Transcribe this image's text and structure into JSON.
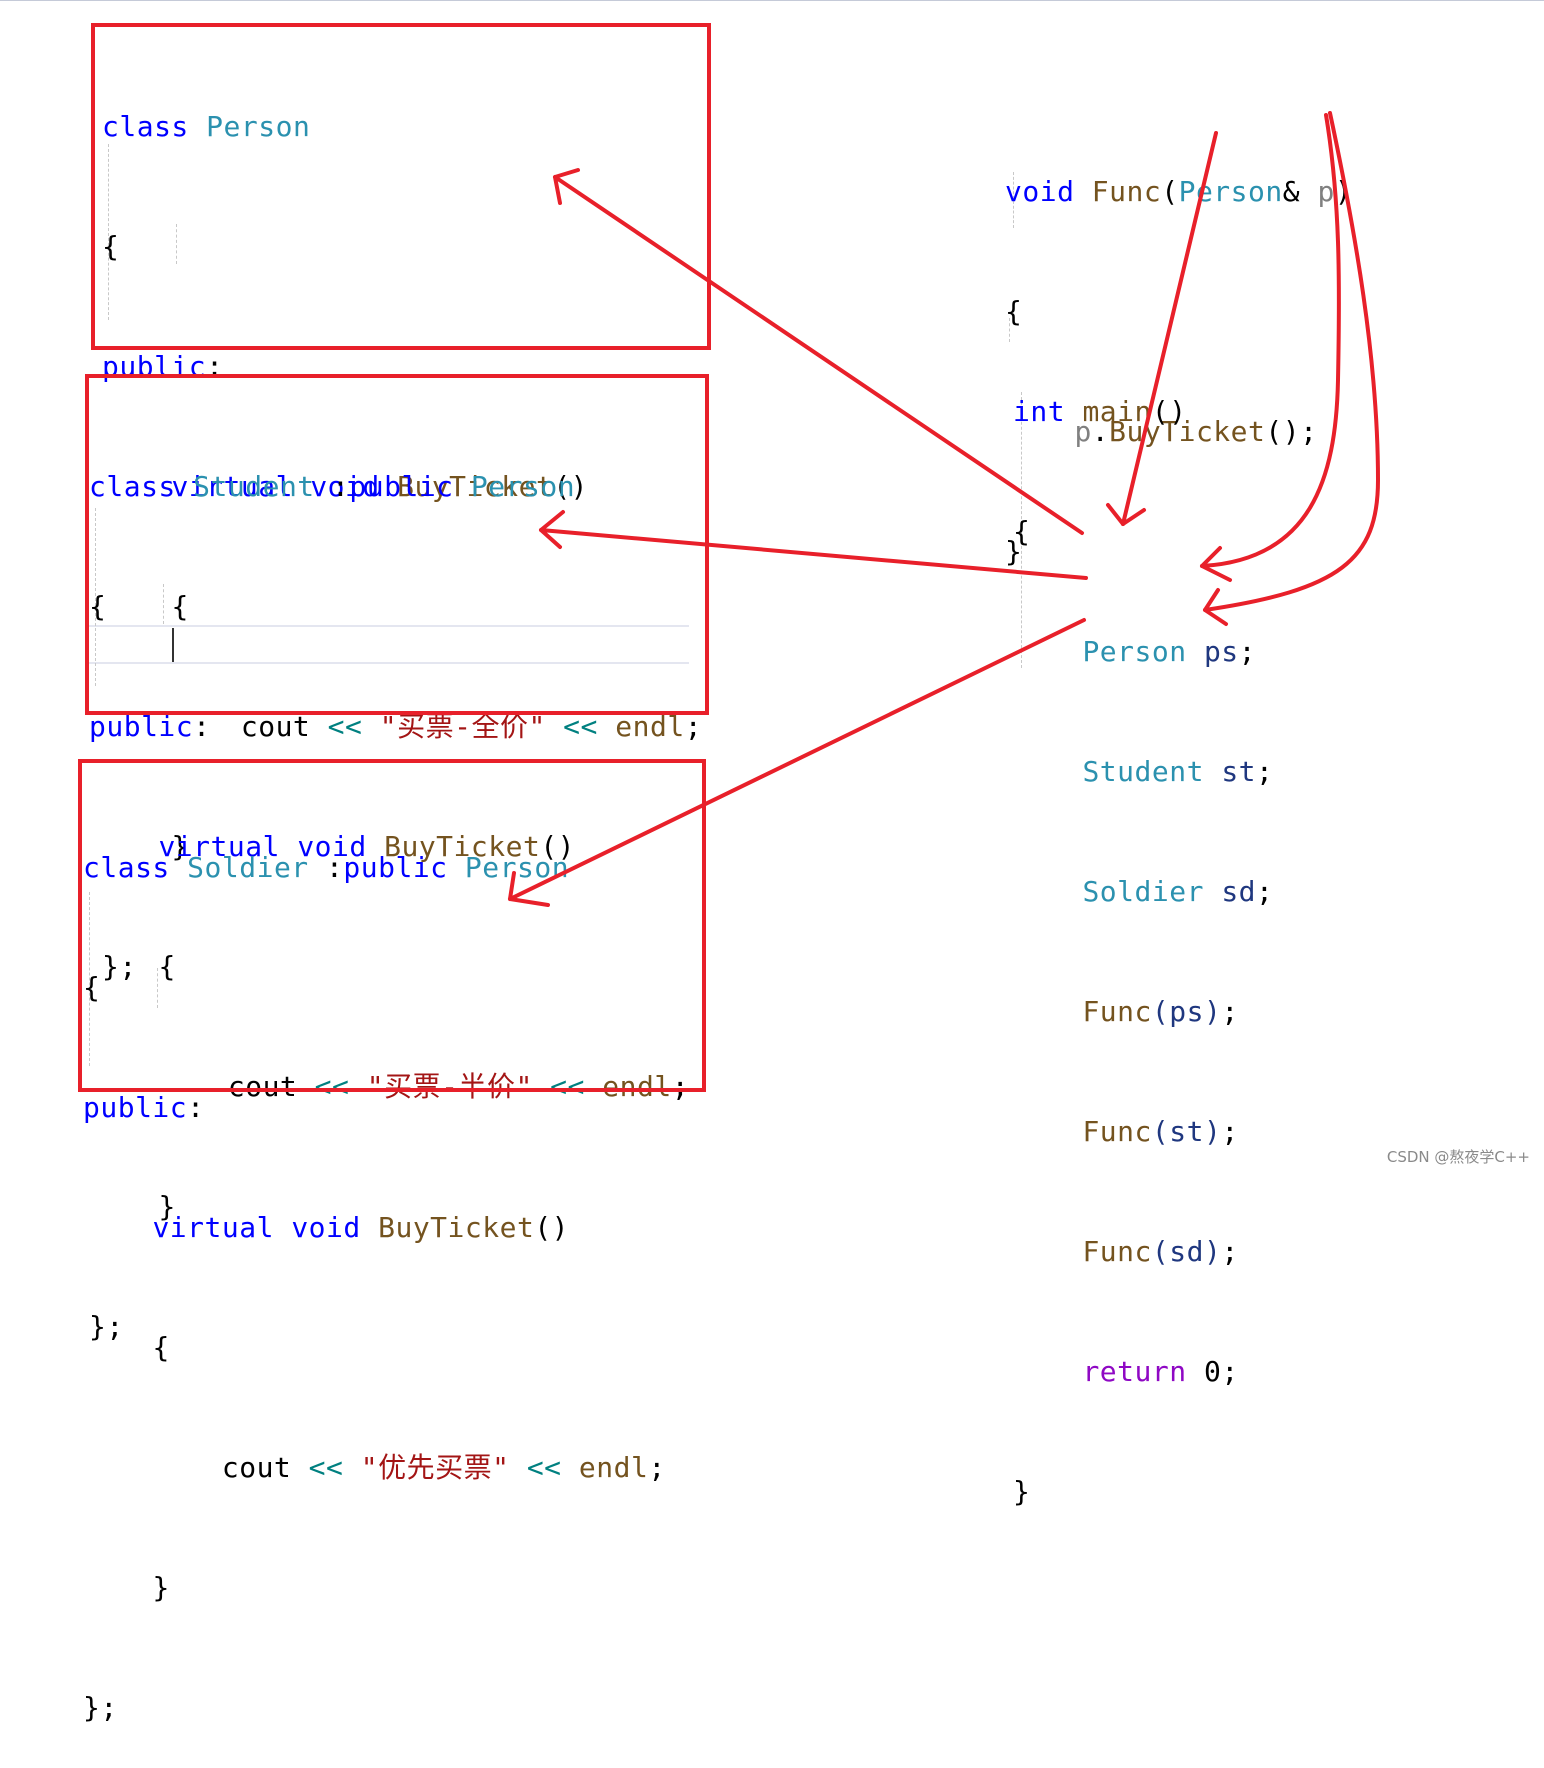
{
  "colors": {
    "keyword": "#0000ff",
    "type": "#2b91af",
    "function": "#74531f",
    "string": "#a31515",
    "operator": "#008080",
    "parameter": "#808080",
    "local": "#1f377f",
    "control": "#8f08c4",
    "annotation": "#e8202a"
  },
  "person_block": {
    "l1": {
      "kw": "class",
      "name": "Person"
    },
    "l2": "{",
    "l3": {
      "kw": "public",
      "colon": ":"
    },
    "l4": {
      "virt": "virtual",
      "void": "void",
      "fn": "BuyTicket",
      "parens": "()"
    },
    "l5": "{",
    "l6": {
      "cout": "cout",
      "op1": "<<",
      "str": "\"买票-全价\"",
      "op2": "<<",
      "endl": "endl",
      "semi": ";"
    },
    "l7": "}",
    "l8": "};"
  },
  "student_block": {
    "l1": {
      "kw": "class",
      "name": "Student",
      "colon": " :",
      "pub": "public",
      "base": "Person"
    },
    "l2": "{",
    "l3": {
      "kw": "public",
      "colon": ":"
    },
    "l4": {
      "virt": "virtual",
      "void": "void",
      "fn": "BuyTicket",
      "parens": "()"
    },
    "l5": "{",
    "l6": {
      "cout": "cout",
      "op1": "<<",
      "str": "\"买票-半价\"",
      "op2": "<<",
      "endl": "endl",
      "semi": ";"
    },
    "l7": "}",
    "l8": "};"
  },
  "soldier_block": {
    "l1": {
      "kw": "class",
      "name": "Soldier",
      "colon": " :",
      "pub": "public",
      "base": "Person"
    },
    "l2": "{",
    "l3": {
      "kw": "public",
      "colon": ":"
    },
    "l4": {
      "virt": "virtual",
      "void": "void",
      "fn": "BuyTicket",
      "parens": "()"
    },
    "l5": "{",
    "l6": {
      "cout": "cout",
      "op1": "<<",
      "str": "\"优先买票\"",
      "op2": "<<",
      "endl": "endl",
      "semi": ";"
    },
    "l7": "}",
    "l8": "};"
  },
  "func_block": {
    "sig": {
      "void": "void",
      "fn": "Func",
      "open": "(",
      "type": "Person",
      "amp": "&",
      "param": "p",
      "close": ")"
    },
    "open": "{",
    "body": {
      "obj": "p",
      "dot": ".",
      "fn": "BuyTicket",
      "rest": "();"
    },
    "close": "}"
  },
  "main_block": {
    "sig": {
      "int": "int",
      "fn": "main",
      "parens": "()"
    },
    "open": "{",
    "decls": [
      {
        "type": "Person",
        "var": "ps",
        "semi": ";"
      },
      {
        "type": "Student",
        "var": "st",
        "semi": ";"
      },
      {
        "type": "Soldier",
        "var": "sd",
        "semi": ";"
      }
    ],
    "calls": [
      {
        "fn": "Func",
        "arg": "(ps)",
        "semi": ";"
      },
      {
        "fn": "Func",
        "arg": "(st)",
        "semi": ";"
      },
      {
        "fn": "Func",
        "arg": "(sd)",
        "semi": ";"
      }
    ],
    "ret": {
      "kw": "return",
      "val": "0",
      "semi": ";"
    },
    "close": "}"
  },
  "arrows": [
    {
      "from": "Func(ps)",
      "to": "Person::BuyTicket"
    },
    {
      "from": "Func(st)",
      "to": "Student::BuyTicket"
    },
    {
      "from": "Func(sd)",
      "to": "Soldier::BuyTicket"
    },
    {
      "from": "Person& p",
      "to": "Func(ps)"
    },
    {
      "from": "p",
      "to": "Func(st)"
    },
    {
      "from": "p",
      "to": "Func(sd)"
    }
  ],
  "watermark": "CSDN @熬夜学C++"
}
